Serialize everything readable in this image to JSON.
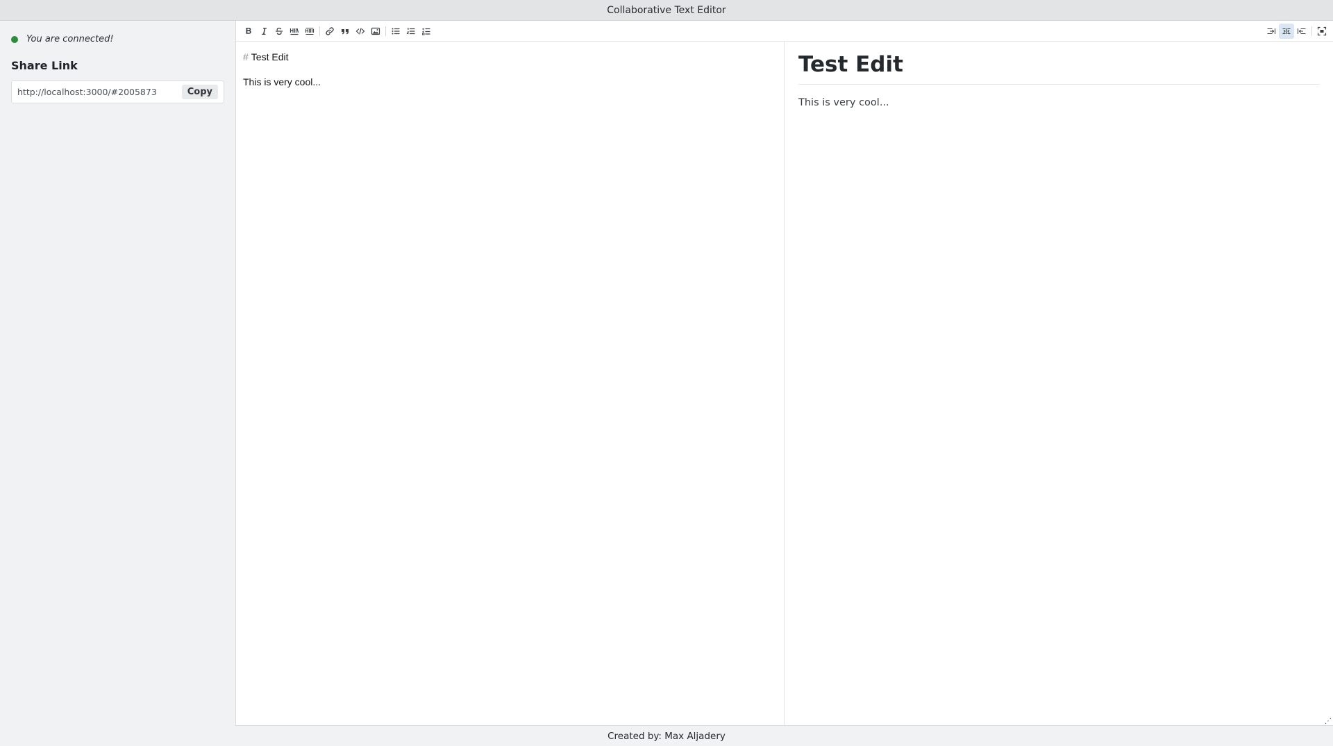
{
  "window": {
    "title": "Collaborative Text Editor"
  },
  "sidebar": {
    "status": {
      "text": "You are connected!",
      "color": "#2e8b3e"
    },
    "share": {
      "heading": "Share Link",
      "url": "http://localhost:3000/#2005873",
      "copy_label": "Copy"
    }
  },
  "toolbar": {
    "left_icons": [
      "bold-icon",
      "italic-icon",
      "strikethrough-icon",
      "heading-icon",
      "heading-smaller-icon",
      "link-icon",
      "quote-icon",
      "code-icon",
      "image-icon",
      "unordered-list-icon",
      "ordered-list-icon",
      "task-list-icon"
    ],
    "right_icons": [
      "editor-only-icon",
      "side-by-side-icon",
      "preview-only-icon",
      "fullscreen-icon"
    ],
    "active_view": "side-by-side"
  },
  "editor": {
    "source_lines": [
      {
        "prefix": "#",
        "text": "Test Edit"
      },
      {
        "prefix": "",
        "text": "This is very cool..."
      }
    ]
  },
  "preview": {
    "heading": "Test Edit",
    "paragraph": "This is very cool..."
  },
  "footer": {
    "text": "Created by: Max Aljadery"
  }
}
